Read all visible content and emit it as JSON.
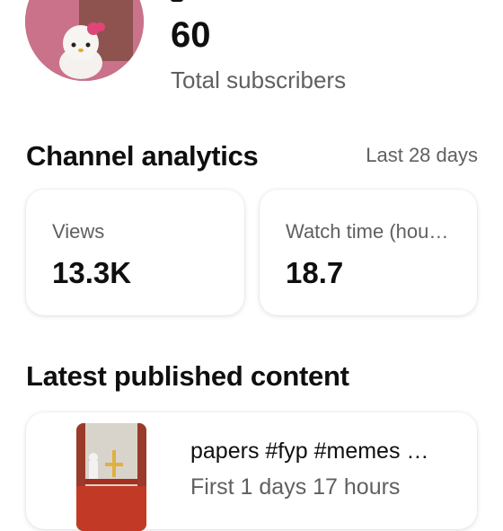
{
  "channel": {
    "subscriber_count": "60",
    "subscriber_label": "Total subscribers"
  },
  "analytics": {
    "title": "Channel analytics",
    "range": "Last 28 days",
    "metrics": [
      {
        "label": "Views",
        "value": "13.3K"
      },
      {
        "label": "Watch time (hou…",
        "value": "18.7"
      }
    ]
  },
  "latest": {
    "title": "Latest published content",
    "video": {
      "title": "papers #fyp #memes …",
      "subtitle": "First 1 days 17 hours"
    }
  },
  "colors": {
    "primary_text": "#0f0f0f",
    "secondary_text": "#606060",
    "background": "#ffffff"
  }
}
